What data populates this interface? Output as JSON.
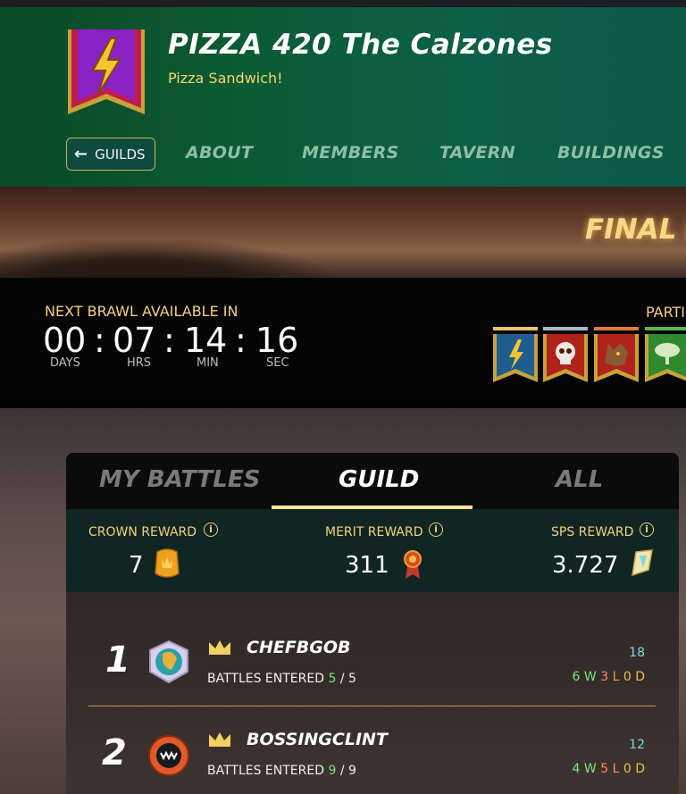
{
  "guild": {
    "name": "PIZZA 420 The Calzones",
    "motto": "Pizza Sandwich!"
  },
  "nav": {
    "back_label": "GUILDS",
    "tabs": [
      "ABOUT",
      "MEMBERS",
      "TAVERN",
      "BUILDINGS"
    ]
  },
  "hero": {
    "title": "FINAL R"
  },
  "brawl": {
    "next_label": "NEXT BRAWL AVAILABLE IN",
    "days": "00",
    "hrs": "07",
    "min": "14",
    "sec": "16",
    "sep": ":",
    "units": {
      "days": "DAYS",
      "hrs": "HRS",
      "min": "MIN",
      "sec": "SEC"
    },
    "participants_label": "PARTI",
    "flags": [
      {
        "icon": "lightning-flag-icon",
        "color": "#1f5c8f",
        "bar": "#e8c66a"
      },
      {
        "icon": "skull-flag-icon",
        "color": "#b0231c",
        "bar": "#a9b7c6"
      },
      {
        "icon": "wolf-flag-icon",
        "color": "#b0231c",
        "bar": "#e07a3a"
      },
      {
        "icon": "tree-flag-icon",
        "color": "#2f8a2f",
        "bar": "#5ab84d"
      }
    ]
  },
  "panel": {
    "tabs": {
      "my_battles": "MY BATTLES",
      "guild": "GUILD",
      "all": "ALL"
    },
    "active_tab": "GUILD",
    "rewards": {
      "crown": {
        "label": "CROWN REWARD",
        "value": "7"
      },
      "merit": {
        "label": "MERIT REWARD",
        "value": "311"
      },
      "sps": {
        "label": "SPS REWARD",
        "value": "3.727"
      }
    },
    "info_glyph": "i"
  },
  "rankings": [
    {
      "rank": "1",
      "name": "CHEFBGOB",
      "battles_label": "BATTLES ENTERED",
      "entered": "5",
      "slash": "/",
      "total": "5",
      "score": "18",
      "w": "6",
      "w_label": "W",
      "l": "3",
      "l_label": "L",
      "d": "0",
      "d_label": "D"
    },
    {
      "rank": "2",
      "name": "BOSSINGCLINT",
      "battles_label": "BATTLES ENTERED",
      "entered": "9",
      "slash": "/",
      "total": "9",
      "score": "12",
      "w": "4",
      "w_label": "W",
      "l": "5",
      "l_label": "L",
      "d": "0",
      "d_label": "D"
    }
  ],
  "colors": {
    "header_green": "#0b5b33",
    "gold": "#f5d07a",
    "win": "#7ee37e",
    "loss": "#ff8c5a",
    "draw": "#e7c24a",
    "score": "#7fd6dd"
  }
}
